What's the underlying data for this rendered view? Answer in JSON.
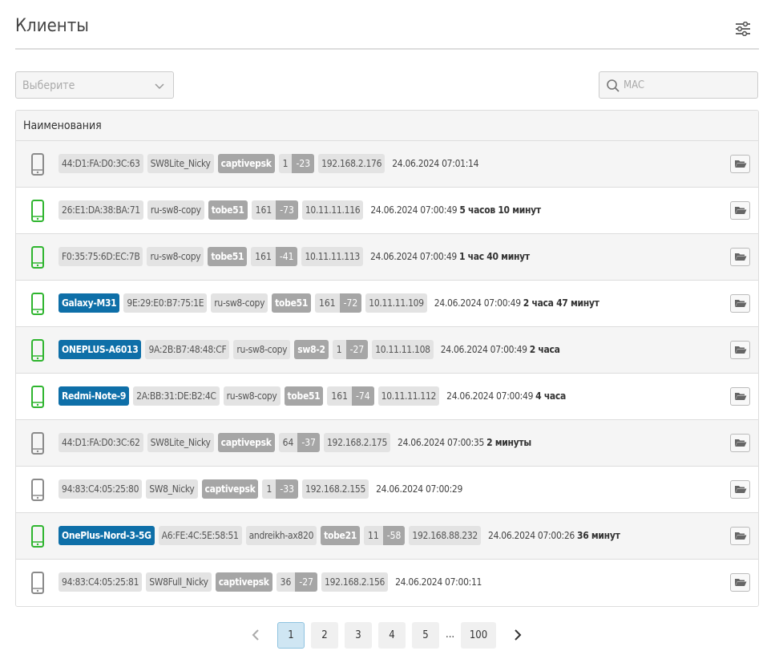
{
  "header": {
    "title": "Клиенты",
    "filter_icon": "filter-settings-icon"
  },
  "filters": {
    "select_placeholder": "Выберите",
    "search_placeholder": "MAC"
  },
  "table": {
    "column_header": "Наименования",
    "rows": [
      {
        "online": false,
        "name": "",
        "mac": "44:D1:FA:D0:3C:63",
        "ap": "SW8Lite_Nicky",
        "ssid": "captivepsk",
        "channel": "1",
        "rssi": "-23",
        "ip": "192.168.2.176",
        "datetime": "24.06.2024 07:01:14",
        "duration": ""
      },
      {
        "online": true,
        "name": "",
        "mac": "26:E1:DA:38:BA:71",
        "ap": "ru-sw8-copy",
        "ssid": "tobe51",
        "channel": "161",
        "rssi": "-73",
        "ip": "10.11.11.116",
        "datetime": "24.06.2024 07:00:49",
        "duration": "5 часов 10 минут"
      },
      {
        "online": true,
        "name": "",
        "mac": "F0:35:75:6D:EC:7B",
        "ap": "ru-sw8-copy",
        "ssid": "tobe51",
        "channel": "161",
        "rssi": "-41",
        "ip": "10.11.11.113",
        "datetime": "24.06.2024 07:00:49",
        "duration": "1 час 40 минут"
      },
      {
        "online": true,
        "name": "Galaxy-M31",
        "mac": "9E:29:E0:B7:75:1E",
        "ap": "ru-sw8-copy",
        "ssid": "tobe51",
        "channel": "161",
        "rssi": "-72",
        "ip": "10.11.11.109",
        "datetime": "24.06.2024 07:00:49",
        "duration": "2 часа 47 минут"
      },
      {
        "online": true,
        "name": "ONEPLUS-A6013",
        "mac": "9A:2B:B7:48:48:CF",
        "ap": "ru-sw8-copy",
        "ssid": "sw8-2",
        "channel": "1",
        "rssi": "-27",
        "ip": "10.11.11.108",
        "datetime": "24.06.2024 07:00:49",
        "duration": "2 часа"
      },
      {
        "online": true,
        "name": "Redmi-Note-9",
        "mac": "2A:BB:31:DE:B2:4C",
        "ap": "ru-sw8-copy",
        "ssid": "tobe51",
        "channel": "161",
        "rssi": "-74",
        "ip": "10.11.11.112",
        "datetime": "24.06.2024 07:00:49",
        "duration": "4 часа"
      },
      {
        "online": false,
        "name": "",
        "mac": "44:D1:FA:D0:3C:62",
        "ap": "SW8Lite_Nicky",
        "ssid": "captivepsk",
        "channel": "64",
        "rssi": "-37",
        "ip": "192.168.2.175",
        "datetime": "24.06.2024 07:00:35",
        "duration": "2 минуты"
      },
      {
        "online": false,
        "name": "",
        "mac": "94:83:C4:05:25:80",
        "ap": "SW8_Nicky",
        "ssid": "captivepsk",
        "channel": "1",
        "rssi": "-33",
        "ip": "192.168.2.155",
        "datetime": "24.06.2024 07:00:29",
        "duration": ""
      },
      {
        "online": true,
        "name": "OnePlus-Nord-3-5G",
        "mac": "A6:FE:4C:5E:58:51",
        "ap": "andreikh-ax820",
        "ssid": "tobe21",
        "channel": "11",
        "rssi": "-58",
        "ip": "192.168.88.232",
        "datetime": "24.06.2024 07:00:26",
        "duration": "36 минут"
      },
      {
        "online": false,
        "name": "",
        "mac": "94:83:C4:05:25:81",
        "ap": "SW8Full_Nicky",
        "ssid": "captivepsk",
        "channel": "36",
        "rssi": "-27",
        "ip": "192.168.2.156",
        "datetime": "24.06.2024 07:00:11",
        "duration": ""
      }
    ]
  },
  "pagination": {
    "pages": [
      "1",
      "2",
      "3",
      "4",
      "5"
    ],
    "ellipsis": "...",
    "last_page": "100",
    "current": "1"
  },
  "colors": {
    "online": "#2fb52f",
    "offline": "#8a8a8a",
    "name_badge": "#0e6fa8",
    "ssid_badge": "#a6a6a6",
    "active_page": "#cfe6f3"
  }
}
